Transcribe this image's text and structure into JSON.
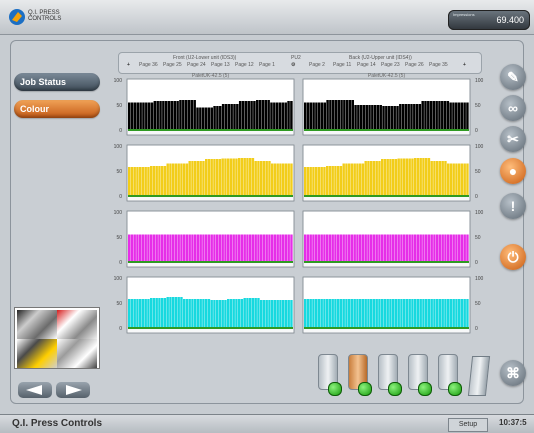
{
  "topbar": {
    "logo_text": [
      "Q.I. PRESS",
      "CONTROLS"
    ],
    "counter_label": "Impressions",
    "counter_value": "69.400"
  },
  "sidebar": {
    "job_status_label": "Job Status",
    "colour_label": "Colour"
  },
  "header": {
    "front_unit": "Front (U2-Lower unit (IDS3))",
    "pu_label": "PU2",
    "back_unit": "Back (U2-Upper unit (IDS4))",
    "pages_left": [
      "Page 36",
      "Page 25",
      "Page 24",
      "Page 13",
      "Page 12",
      "Page 1"
    ],
    "pages_right": [
      "Page 2",
      "Page 11",
      "Page 14",
      "Page 23",
      "Page 26",
      "Page 35"
    ]
  },
  "chart_data": [
    {
      "type": "bar",
      "title": "PaletUK-42.5 (5)",
      "series": [
        {
          "values": [
            55,
            55,
            55,
            55,
            55,
            55,
            55,
            55,
            55,
            58,
            58,
            58,
            58,
            58,
            58,
            58,
            58,
            58,
            60,
            60,
            60,
            60,
            60,
            60,
            45,
            45,
            45,
            45,
            45,
            45,
            48,
            48,
            48,
            52,
            52,
            52,
            52,
            52,
            52,
            58,
            58,
            58,
            58,
            58,
            58,
            60,
            60,
            60,
            60,
            60,
            55,
            55,
            55,
            55,
            55,
            55,
            58,
            58
          ]
        }
      ],
      "color": "#000000",
      "ylim": [
        0,
        100
      ],
      "yticks": [
        0,
        50,
        100
      ]
    },
    {
      "type": "bar",
      "title": "PaletUK-42.5 (5)",
      "series": [
        {
          "values": [
            55,
            55,
            55,
            55,
            55,
            55,
            55,
            55,
            60,
            60,
            60,
            60,
            60,
            60,
            60,
            60,
            60,
            60,
            50,
            50,
            50,
            50,
            50,
            50,
            50,
            50,
            50,
            50,
            48,
            48,
            48,
            48,
            48,
            48,
            52,
            52,
            52,
            52,
            52,
            52,
            52,
            52,
            58,
            58,
            58,
            58,
            58,
            58,
            58,
            58,
            58,
            58,
            55,
            55,
            55,
            55,
            55,
            55,
            55
          ]
        }
      ],
      "color": "#000000",
      "ylim": [
        0,
        100
      ],
      "yticks": [
        0,
        50,
        100
      ]
    },
    {
      "type": "bar",
      "series": [
        {
          "values": [
            58,
            58,
            58,
            58,
            58,
            58,
            58,
            58,
            60,
            60,
            60,
            60,
            60,
            60,
            65,
            65,
            65,
            65,
            65,
            65,
            65,
            65,
            70,
            70,
            70,
            70,
            70,
            70,
            74,
            74,
            74,
            74,
            74,
            74,
            75,
            75,
            75,
            75,
            75,
            75,
            76,
            76,
            76,
            76,
            76,
            76,
            70,
            70,
            70,
            70,
            70,
            70,
            65,
            65,
            65,
            65,
            65,
            65,
            65,
            65
          ]
        }
      ],
      "color": "#f2cd19",
      "ylim": [
        0,
        100
      ],
      "yticks": [
        0,
        50,
        100
      ]
    },
    {
      "type": "bar",
      "series": [
        {
          "values": [
            58,
            58,
            58,
            58,
            58,
            58,
            58,
            58,
            60,
            60,
            60,
            60,
            60,
            60,
            65,
            65,
            65,
            65,
            65,
            65,
            65,
            65,
            70,
            70,
            70,
            70,
            70,
            70,
            74,
            74,
            74,
            74,
            74,
            74,
            75,
            75,
            75,
            75,
            75,
            75,
            76,
            76,
            76,
            76,
            76,
            76,
            70,
            70,
            70,
            70,
            70,
            70,
            65,
            65,
            65,
            65,
            65,
            65,
            65,
            65
          ]
        }
      ],
      "color": "#f2cd19",
      "ylim": [
        0,
        100
      ],
      "yticks": [
        0,
        50,
        100
      ]
    },
    {
      "type": "bar",
      "series": [
        {
          "values": [
            55,
            55,
            55,
            55,
            55,
            55,
            55,
            55,
            55,
            55,
            55,
            55,
            55,
            55,
            55,
            55,
            55,
            55,
            55,
            55,
            55,
            55,
            55,
            55,
            55,
            55,
            55,
            55,
            55,
            55,
            55,
            55,
            55,
            55,
            55,
            55,
            55,
            55,
            55,
            55,
            55,
            55,
            55,
            55,
            55,
            55,
            55,
            55,
            55,
            55,
            55,
            55,
            55,
            55,
            55,
            55,
            55,
            55,
            55,
            55
          ]
        }
      ],
      "color": "#e62ee8",
      "ylim": [
        0,
        100
      ],
      "yticks": [
        0,
        50,
        100
      ]
    },
    {
      "type": "bar",
      "series": [
        {
          "values": [
            55,
            55,
            55,
            55,
            55,
            55,
            55,
            55,
            55,
            55,
            55,
            55,
            55,
            55,
            55,
            55,
            55,
            55,
            55,
            55,
            55,
            55,
            55,
            55,
            55,
            55,
            55,
            55,
            55,
            55,
            55,
            55,
            55,
            55,
            55,
            55,
            55,
            55,
            55,
            55,
            55,
            55,
            55,
            55,
            55,
            55,
            55,
            55,
            55,
            55,
            55,
            55,
            55,
            55,
            55,
            55,
            55,
            55,
            55,
            55
          ]
        }
      ],
      "color": "#e62ee8",
      "ylim": [
        0,
        100
      ],
      "yticks": [
        0,
        50,
        100
      ]
    },
    {
      "type": "bar",
      "series": [
        {
          "values": [
            58,
            58,
            58,
            58,
            58,
            58,
            58,
            58,
            60,
            60,
            60,
            60,
            60,
            60,
            62,
            62,
            62,
            62,
            62,
            62,
            58,
            58,
            58,
            58,
            58,
            58,
            58,
            58,
            58,
            58,
            56,
            56,
            56,
            56,
            56,
            56,
            58,
            58,
            58,
            58,
            58,
            58,
            60,
            60,
            60,
            60,
            60,
            60,
            56,
            56,
            56,
            56,
            56,
            56,
            56,
            56,
            56,
            56,
            56,
            56
          ]
        }
      ],
      "color": "#17d9df",
      "ylim": [
        0,
        100
      ],
      "yticks": [
        0,
        50,
        100
      ]
    },
    {
      "type": "bar",
      "series": [
        {
          "values": [
            58,
            58,
            58,
            58,
            58,
            58,
            58,
            58,
            58,
            58,
            58,
            58,
            58,
            58,
            58,
            58,
            58,
            58,
            58,
            58,
            58,
            58,
            58,
            58,
            58,
            58,
            58,
            58,
            58,
            58,
            58,
            58,
            58,
            58,
            58,
            58,
            58,
            58,
            58,
            58,
            58,
            58,
            58,
            58,
            58,
            58,
            58,
            58,
            58,
            58,
            58,
            58,
            58,
            58,
            58,
            58,
            58,
            58,
            58,
            58
          ]
        }
      ],
      "color": "#17d9df",
      "ylim": [
        0,
        100
      ],
      "yticks": [
        0,
        50,
        100
      ]
    }
  ],
  "status": {
    "app_name": "Q.I. Press Controls",
    "setup_label": "Setup",
    "time": "10:37:5"
  },
  "icons": {
    "wrench": "wrench-icon",
    "link": "link-icon",
    "tool": "tool-icon",
    "ink_drop": "ink-drop-icon",
    "warning": "warning-icon",
    "power": "power-icon",
    "press": "press-icon"
  }
}
